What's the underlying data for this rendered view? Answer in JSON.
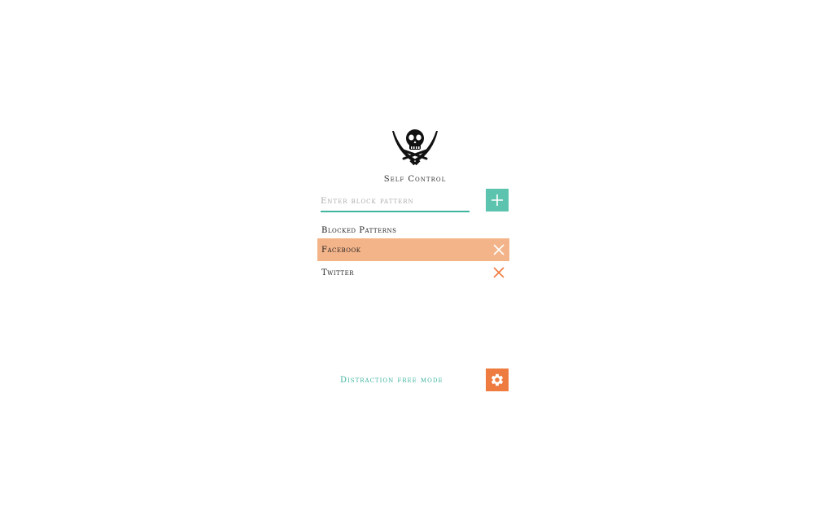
{
  "app": {
    "title": "Self Control",
    "logo_icon": "jolly-roger-skull-crossed-swords-icon"
  },
  "input": {
    "placeholder": "Enter block pattern",
    "value": ""
  },
  "add_button": {
    "icon": "plus-icon",
    "color": "#5cc3ae"
  },
  "blocked": {
    "heading": "Blocked Patterns",
    "items": [
      {
        "label": "Facebook",
        "highlighted": true
      },
      {
        "label": "Twitter",
        "highlighted": false
      }
    ],
    "remove_icon": "close-x-icon",
    "highlight_color": "#f4b48a",
    "remove_color": "#ee7b3f"
  },
  "footer": {
    "mode_label": "Distraction free mode",
    "settings_icon": "gear-icon",
    "settings_color": "#ee7b3f",
    "accent_color": "#3fb5a0"
  }
}
